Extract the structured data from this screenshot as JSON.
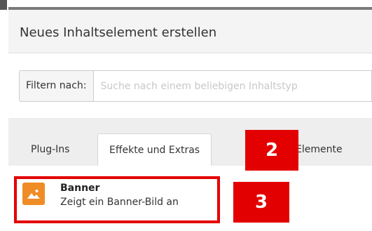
{
  "modal": {
    "title": "Neues Inhaltselement erstellen"
  },
  "filter": {
    "label": "Filtern nach:",
    "placeholder": "Suche nach einem beliebigen Inhaltstyp"
  },
  "tabs": [
    {
      "label": "Plug-Ins",
      "active": false
    },
    {
      "label": "Effekte und Extras",
      "active": true
    },
    {
      "label": "Elemente",
      "active": false
    }
  ],
  "element": {
    "title": "Banner",
    "description": "Zeigt ein Banner-Bild an",
    "icon": "image-icon",
    "icon_color": "#f08c26"
  },
  "annotations": {
    "marker_2": "2",
    "marker_3": "3",
    "color": "#e30000"
  }
}
